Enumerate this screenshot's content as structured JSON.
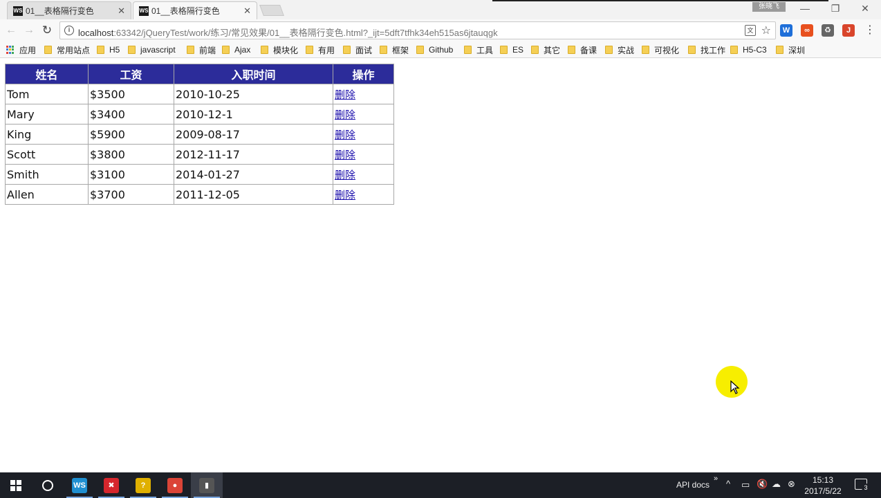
{
  "browser": {
    "tabs": [
      {
        "favicon": "WS",
        "title": "01__表格隔行变色",
        "close": "✕",
        "active": false
      },
      {
        "favicon": "WS",
        "title": "01__表格隔行变色",
        "close": "✕",
        "active": true
      }
    ],
    "user_badge": "张晓飞",
    "window_controls": {
      "minimize": "—",
      "restore": "❐",
      "close": "✕"
    },
    "url_host": "localhost",
    "url_rest": ":63342/jQueryTest/work/练习/常见效果/01__表格隔行变色.html?_ijt=5dft7tfhk34eh515as6jtauqgk",
    "translate_icon_text": "文",
    "extensions": [
      {
        "name": "w-extension-icon",
        "glyph": "W",
        "color": "#1e6fd9"
      },
      {
        "name": "infinity-extension-icon",
        "glyph": "∞",
        "color": "#e8501e"
      },
      {
        "name": "recycle-extension-icon",
        "glyph": "♻",
        "color": "#666666"
      },
      {
        "name": "j-extension-icon",
        "glyph": "J",
        "color": "#d9452b"
      }
    ],
    "bookmarks": {
      "apps_label": "应用",
      "items": [
        "常用站点",
        "H5",
        "javascript",
        "前端",
        "Ajax",
        "模块化",
        "有用",
        "面试",
        "框架",
        "Github",
        "工具",
        "ES",
        "其它",
        "备课",
        "实战",
        "可视化",
        "找工作",
        "H5-C3",
        "深圳"
      ]
    }
  },
  "table": {
    "headers": [
      "姓名",
      "工资",
      "入职时间",
      "操作"
    ],
    "rows": [
      {
        "name": "Tom",
        "salary": "$3500",
        "date": "2010-10-25",
        "action": "删除"
      },
      {
        "name": "Mary",
        "salary": "$3400",
        "date": "2010-12-1",
        "action": "删除"
      },
      {
        "name": "King",
        "salary": "$5900",
        "date": "2009-08-17",
        "action": "删除"
      },
      {
        "name": "Scott",
        "salary": "$3800",
        "date": "2012-11-17",
        "action": "删除"
      },
      {
        "name": "Smith",
        "salary": "$3100",
        "date": "2014-01-27",
        "action": "删除"
      },
      {
        "name": "Allen",
        "salary": "$3700",
        "date": "2011-12-05",
        "action": "删除"
      }
    ],
    "header_bg": "#2c2c9a"
  },
  "taskbar": {
    "apps": [
      {
        "name": "webstorm-taskbar-icon",
        "glyph": "WS",
        "color": "#1f8fd1"
      },
      {
        "name": "xmind-taskbar-icon",
        "glyph": "✖",
        "color": "#d6262d"
      },
      {
        "name": "help-taskbar-icon",
        "glyph": "?",
        "color": "#e0b000"
      },
      {
        "name": "chrome-taskbar-icon",
        "glyph": "●",
        "color": "#db4437"
      },
      {
        "name": "recorder-taskbar-icon",
        "glyph": "▮",
        "color": "#555555"
      }
    ],
    "api_docs": "API docs",
    "time": "15:13",
    "date": "2017/5/22",
    "notification_count": "3"
  }
}
